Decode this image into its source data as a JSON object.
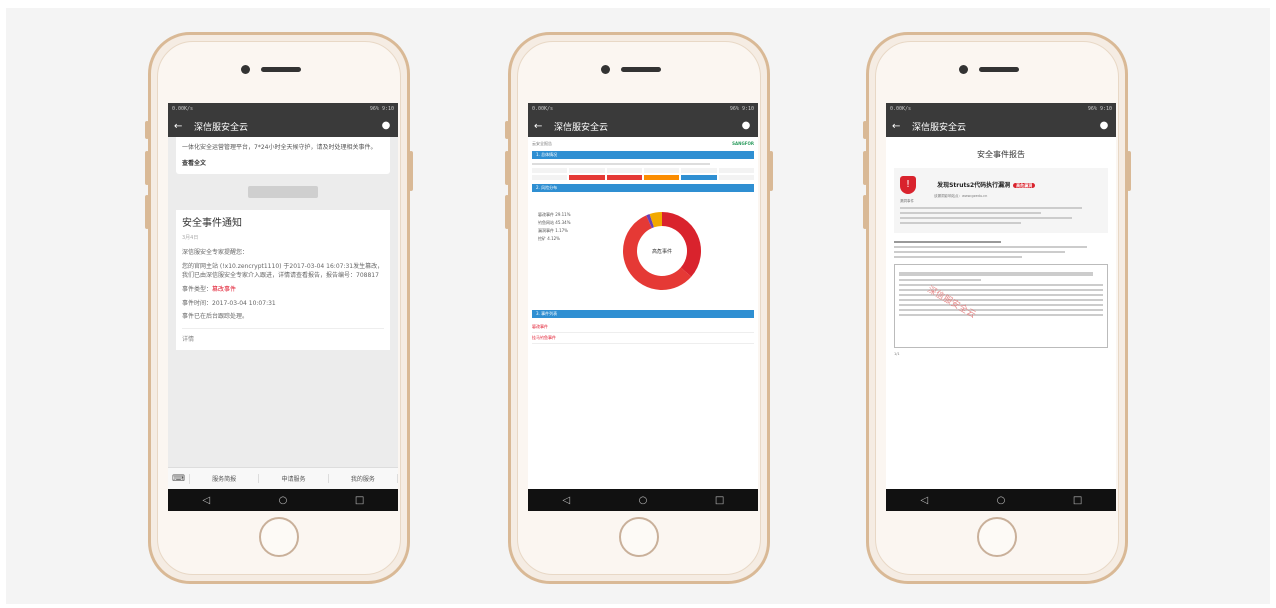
{
  "screens": [
    {
      "status_left": "0.00K/s",
      "status_right": "96% 9:10",
      "app_title": "深信服安全云",
      "prev_text": "一体化安全运营管理平台，7*24小时全天候守护，请及时处理相关事件。",
      "read_more": "查看全文",
      "time_label": "",
      "event_title": "安全事件通知",
      "event_date": "3月4日",
      "greeting": "深信服安全专家提醒您：",
      "body": "您的官网主站 (!x10.zencrypt1110) 于2017-03-04 16:07:31发生篡改，我们已由深信服安全专家介入跟进，详情请查看报告，报告编号：708817",
      "event_type_label": "事件类型：",
      "event_type_value": "篡改事件",
      "event_time": "事件时间：2017-03-04 10:07:31",
      "event_status": "事件已在后台跟踪处理。",
      "detail": "详情",
      "tabs": [
        "服务简报",
        "申请服务",
        "我的服务"
      ]
    },
    {
      "status_left": "0.00K/s",
      "status_right": "96% 9:10",
      "app_title": "深信服安全云",
      "header_left": "云安全报告",
      "header_right": "SANGFOR",
      "section1": "1. 总体情况",
      "section2": "2. 风险分布",
      "section3": "3. 事件列表",
      "donut_center": "高危事件",
      "legend": [
        "篡改事件 29.11%",
        "钓鱼网站 45.34%",
        "漏洞事件 1.17%",
        "挖矿 4.12%"
      ],
      "rows": [
        "篡改事件",
        "挂马钓鱼事件"
      ]
    },
    {
      "status_left": "0.00K/s",
      "status_right": "96% 9:10",
      "app_title": "深信服安全云",
      "report_title": "安全事件报告",
      "vuln_title": "发现Struts2代码执行漏洞",
      "tag": "高危漏洞",
      "sub": "该漏洞影响站点：www.gzedu.cn",
      "shield_label": "漏洞事件",
      "watermark": "深信服安全云",
      "foot": "1/1"
    }
  ],
  "chart_data": {
    "type": "pie",
    "title": "",
    "values": [
      {
        "label": "篡改事件",
        "value": 29.11
      },
      {
        "label": "钓鱼网站",
        "value": 45.34
      },
      {
        "label": "漏洞事件",
        "value": 1.17
      },
      {
        "label": "挖矿",
        "value": 4.12
      }
    ]
  },
  "colors": {
    "accent_red": "#d9232d",
    "blue": "#2f8fd2",
    "frame": "#d9b996"
  }
}
